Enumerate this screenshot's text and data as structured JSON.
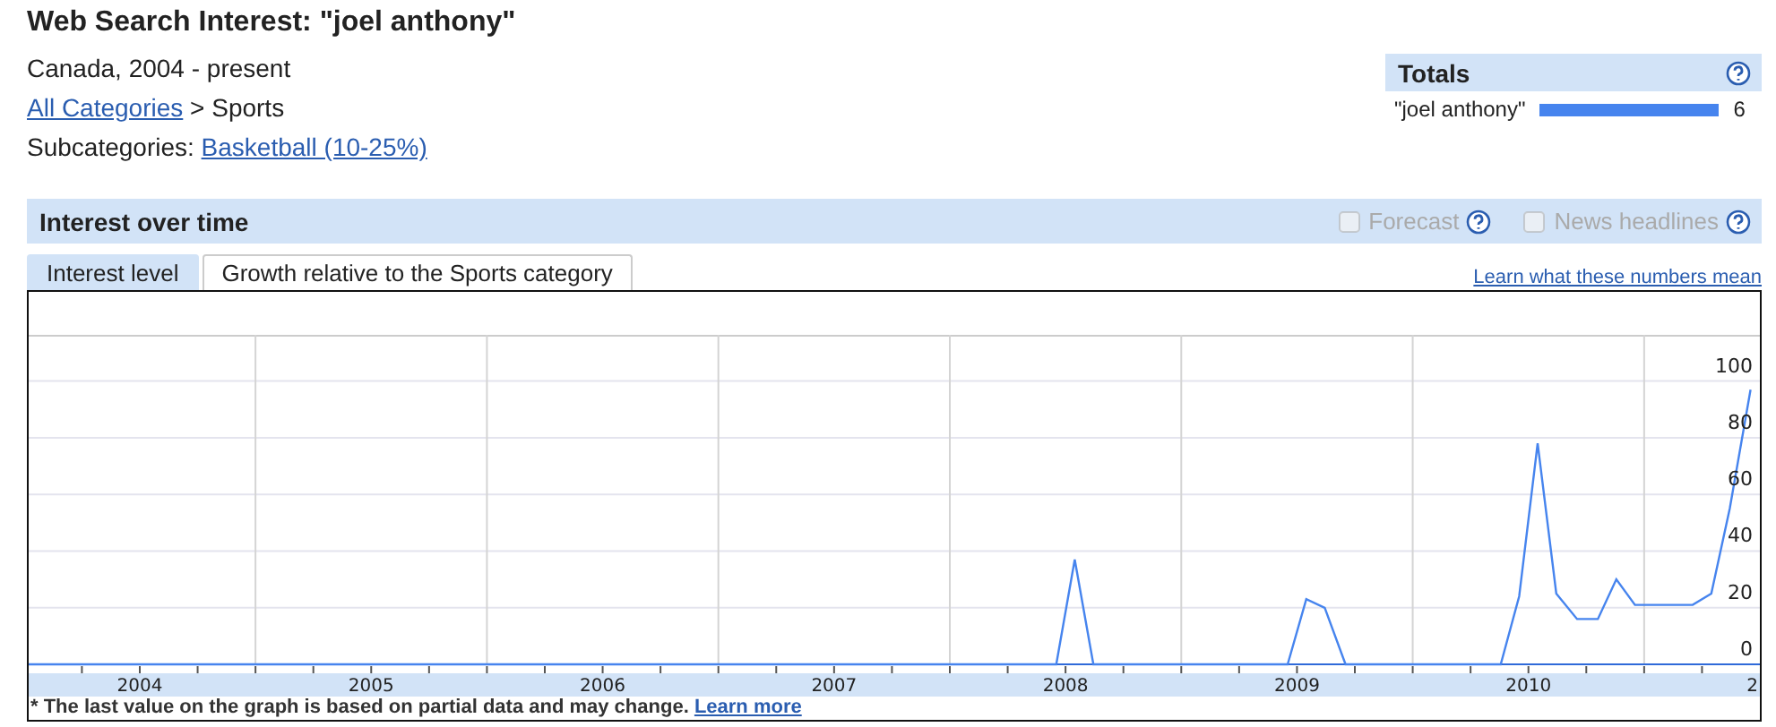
{
  "header": {
    "title": "Web Search Interest: \"joel anthony\"",
    "region_range": "Canada, 2004 - present",
    "breadcrumb": {
      "link": "All Categories",
      "current": "> Sports"
    },
    "subcategories": {
      "label": "Subcategories:",
      "link": "Basketball (10-25%)"
    }
  },
  "totals": {
    "title": "Totals",
    "rows": [
      {
        "term": "\"joel anthony\"",
        "level": 1,
        "value": "6"
      }
    ]
  },
  "interest_panel": {
    "title": "Interest over time",
    "options": [
      {
        "label": "Forecast",
        "checked": false,
        "disabled": true
      },
      {
        "label": "News headlines",
        "checked": false,
        "disabled": true
      }
    ],
    "tabs": [
      {
        "label": "Interest level",
        "selected": true
      },
      {
        "label": "Growth relative to the Sports category",
        "selected": false
      }
    ],
    "help_link": "Learn what these numbers mean",
    "chart_data": {
      "type": "line",
      "x": [
        2003.52,
        2007.96,
        2008.04,
        2008.12,
        2008.96,
        2009.04,
        2009.12,
        2009.21,
        2009.88,
        2009.96,
        2010.04,
        2010.12,
        2010.21,
        2010.3,
        2010.38,
        2010.46,
        2010.71,
        2010.79,
        2010.87,
        2010.96
      ],
      "series": [
        {
          "color": "#4684ee",
          "values": [
            0,
            0,
            37,
            0,
            0,
            23,
            20,
            0,
            0,
            24,
            78,
            25,
            16,
            16,
            30,
            21,
            21,
            25,
            55,
            97
          ]
        }
      ],
      "xlim": [
        2003.52,
        2011.0
      ],
      "ylim": [
        0,
        116
      ],
      "grid": true,
      "yticks": [
        0,
        20,
        40,
        60,
        80,
        100
      ],
      "xticks": [
        2004,
        2005,
        2006,
        2007,
        2008,
        2009,
        2010
      ]
    },
    "cut_axis_label": "2",
    "footnote": {
      "text": "* The last value on the graph is based on partial data and may change.",
      "link": "Learn more"
    }
  }
}
